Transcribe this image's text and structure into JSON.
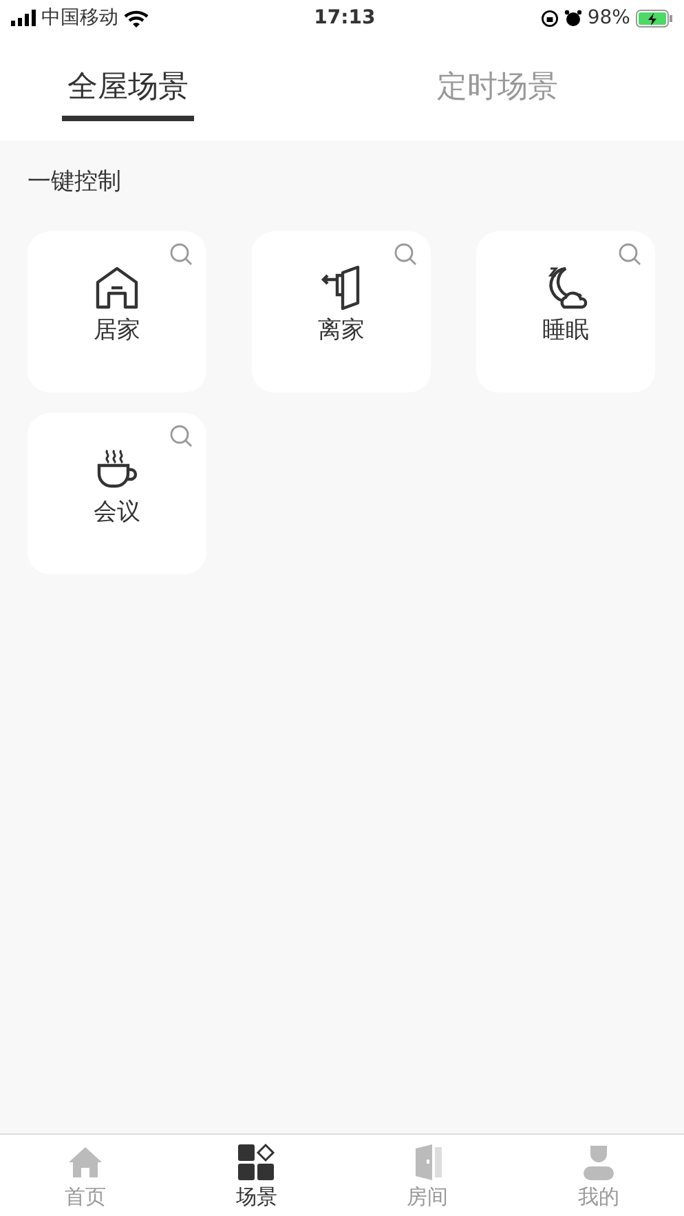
{
  "status_bar": {
    "carrier": "中国移动",
    "time": "17:13",
    "battery": "98%"
  },
  "tabs": [
    {
      "label": "全屋场景",
      "selected": true
    },
    {
      "label": "定时场景",
      "selected": false
    }
  ],
  "section_title": "一键控制",
  "scenes": [
    {
      "label": "居家",
      "kind": "home"
    },
    {
      "label": "离家",
      "kind": "leave"
    },
    {
      "label": "睡眠",
      "kind": "sleep"
    },
    {
      "label": "会议",
      "kind": "coffee"
    }
  ],
  "bottom_nav": [
    {
      "label": "首页",
      "kind": "home",
      "selected": false
    },
    {
      "label": "场景",
      "kind": "scenes",
      "selected": true
    },
    {
      "label": "房间",
      "kind": "room",
      "selected": false
    },
    {
      "label": "我的",
      "kind": "profile",
      "selected": false
    }
  ]
}
